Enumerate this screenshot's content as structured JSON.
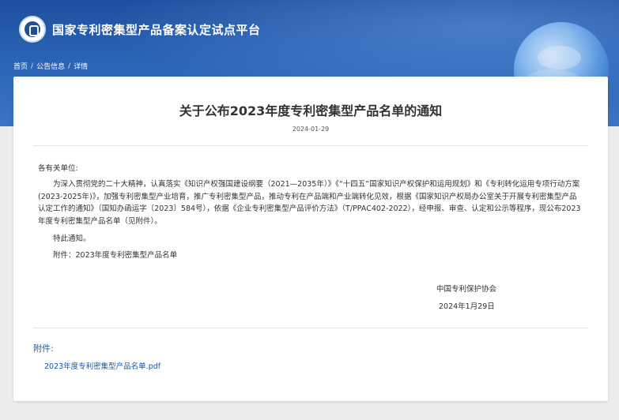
{
  "header": {
    "site_title": "国家专利密集型产品备案认定试点平台",
    "logo_icon": "platform-logo-icon"
  },
  "breadcrumb": {
    "items": [
      "首页",
      "公告信息",
      "详情"
    ],
    "separator": "/"
  },
  "article": {
    "title": "关于公布2023年度专利密集型产品名单的通知",
    "date": "2024-01-29",
    "salutation": "各有关单位:",
    "paragraph": "为深入贯彻党的二十大精神，认真落实《知识产权强国建设纲要（2021—2035年）》《“十四五”国家知识产权保护和运用规划》和《专利转化运用专项行动方案(2023-2025年)》，加强专利密集型产业培育，推广专利密集型产品，推动专利在产品端和产业端转化见效，根据《国家知识产权局办公室关于开展专利密集型产品认定工作的通知》（国知办函运字〔2023〕584号），依据《企业专利密集型产品评价方法》（T/PPAC402-2022），经申报、审查、认定和公示等程序，现公布2023年度专利密集型产品名单（见附件）。",
    "closing": "特此通知。",
    "attachment_note": "附件：2023年度专利密集型产品名单",
    "organization": "中国专利保护协会",
    "sign_date": "2024年1月29日"
  },
  "attachments": {
    "heading": "附件:",
    "files": [
      "2023年度专利密集型产品名单.pdf"
    ]
  },
  "colors": {
    "header_blue": "#1d4f9e",
    "link_blue": "#1a56a8",
    "text": "#333333",
    "page_bg": "#ececec"
  }
}
